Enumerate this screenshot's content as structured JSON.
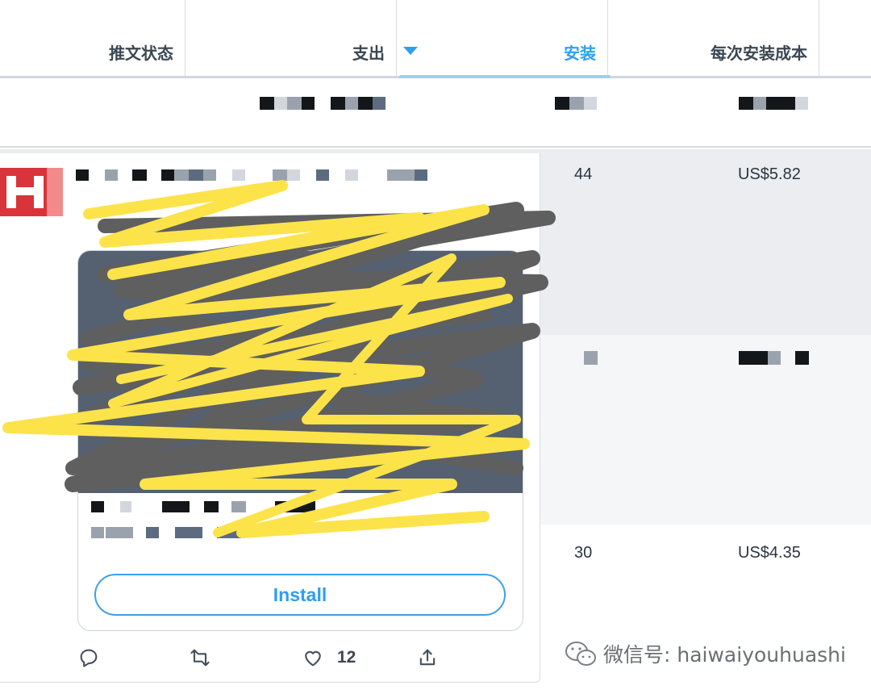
{
  "table": {
    "columns": [
      {
        "label": "推文状态",
        "sorted": false
      },
      {
        "label": "支出",
        "sorted": false
      },
      {
        "label": "安装",
        "sorted": true
      },
      {
        "label": "每次安装成本",
        "sorted": false
      }
    ],
    "rows": [
      {
        "installs": "44",
        "cost_per_install": "US$5.82"
      },
      {
        "installs": "30",
        "cost_per_install": "US$4.35"
      }
    ]
  },
  "tweet": {
    "cta_label": "Install",
    "like_count": "12"
  },
  "watermark": {
    "text": "微信号: haiwaiyouhuashi",
    "icon": "wechat-icon"
  },
  "colors": {
    "accent": "#2e9ef2",
    "scribble_yellow": "#fce34a",
    "scribble_gray": "#5f5f5f"
  }
}
